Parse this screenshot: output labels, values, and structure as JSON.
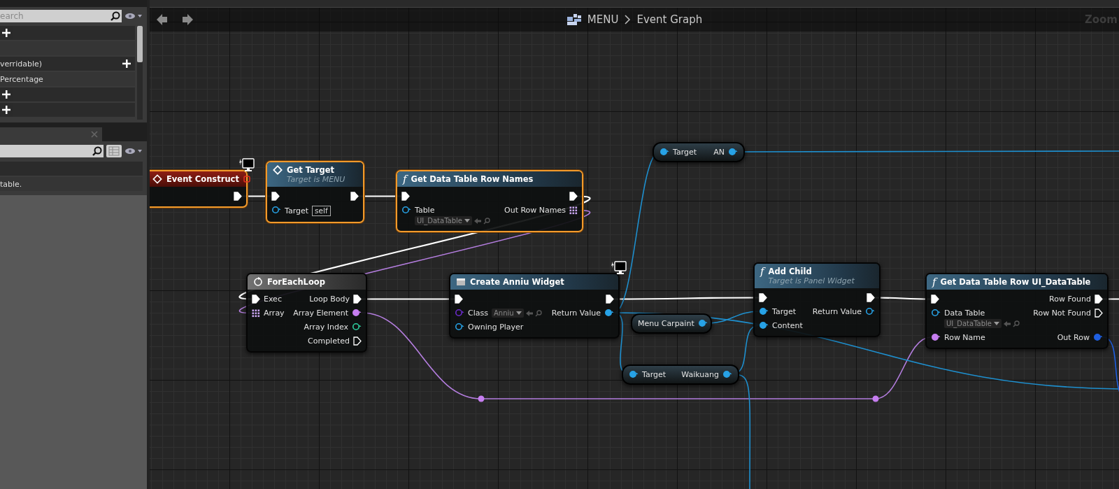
{
  "left_panel": {
    "search": {
      "placeholder": "earch"
    },
    "rows": [
      {
        "kind": "category",
        "addable": true
      },
      {
        "kind": "item"
      },
      {
        "kind": "category",
        "text": "verridable)",
        "addable": true
      },
      {
        "kind": "item",
        "text": "Percentage"
      },
      {
        "kind": "category",
        "addable": true
      },
      {
        "kind": "category",
        "addable": true
      }
    ]
  },
  "details_panel": {
    "closable_tab": true,
    "grid_view": true,
    "rows": [
      {
        "kind": "category"
      },
      {
        "kind": "item",
        "text": "table."
      }
    ]
  },
  "graph_header": {
    "breadcrumb": [
      "MENU",
      "Event Graph"
    ],
    "zoom_label": "Zoom"
  },
  "nodes": [
    {
      "kind": "event",
      "title": "Event Construct",
      "selected": true,
      "client_only": true,
      "delegate_pin": true,
      "outputs": [
        {
          "kind": "exec",
          "connected": true
        }
      ]
    },
    {
      "kind": "function",
      "title": "Get Target",
      "subtitle": "Target is MENU",
      "selected": true,
      "inputs": [
        {
          "kind": "exec",
          "connected": true
        },
        {
          "kind": "object",
          "label": "Target",
          "connected": false,
          "default": {
            "kind": "literal",
            "value": "self"
          }
        }
      ],
      "outputs": [
        {
          "kind": "exec",
          "connected": true
        }
      ]
    },
    {
      "kind": "function",
      "glyph": "f",
      "title": "Get Data Table Row Names",
      "selected": true,
      "inputs": [
        {
          "kind": "exec",
          "connected": true
        },
        {
          "kind": "object",
          "label": "Table",
          "connected": false,
          "default": {
            "kind": "asset",
            "value": "UI_DataTable"
          }
        }
      ],
      "outputs": [
        {
          "kind": "exec",
          "connected": true
        },
        {
          "kind": "array",
          "label": "Out Row Names",
          "connected": true
        }
      ]
    },
    {
      "kind": "macro",
      "title": "ForEachLoop",
      "selected": false,
      "inputs": [
        {
          "kind": "exec",
          "label": "Exec",
          "connected": true
        },
        {
          "kind": "array",
          "label": "Array",
          "connected": true
        }
      ],
      "outputs": [
        {
          "kind": "exec",
          "label": "Loop Body",
          "connected": true
        },
        {
          "kind": "name",
          "label": "Array Element",
          "connected": true
        },
        {
          "kind": "int",
          "label": "Array Index",
          "connected": false
        },
        {
          "kind": "exec",
          "label": "Completed",
          "connected": false
        }
      ]
    },
    {
      "kind": "function",
      "title": "Create Anniu Widget",
      "selected": false,
      "client_only": true,
      "inputs": [
        {
          "kind": "exec",
          "connected": true
        },
        {
          "kind": "class",
          "label": "Class",
          "connected": false,
          "default": {
            "kind": "asset",
            "value": "Anniu"
          }
        },
        {
          "kind": "object",
          "label": "Owning Player",
          "connected": false
        }
      ],
      "outputs": [
        {
          "kind": "exec",
          "connected": true
        },
        {
          "kind": "object",
          "label": "Return Value",
          "connected": true
        }
      ]
    },
    {
      "kind": "variable",
      "selected": false,
      "inputs": [
        {
          "kind": "object",
          "label": "Target",
          "connected": true
        }
      ],
      "outputs": [
        {
          "kind": "object",
          "label": "AN",
          "connected": true
        }
      ]
    },
    {
      "kind": "variable",
      "selected": false,
      "outputs": [
        {
          "kind": "object",
          "label": "Menu Carpaint",
          "connected": true
        }
      ]
    },
    {
      "kind": "variable",
      "selected": false,
      "inputs": [
        {
          "kind": "object",
          "label": "Target",
          "connected": true
        }
      ],
      "outputs": [
        {
          "kind": "object",
          "label": "Waikuang",
          "connected": true
        }
      ]
    },
    {
      "kind": "function",
      "glyph": "f",
      "title": "Add Child",
      "subtitle": "Target is Panel Widget",
      "selected": false,
      "inputs": [
        {
          "kind": "exec",
          "connected": true
        },
        {
          "kind": "object",
          "label": "Target",
          "connected": true
        },
        {
          "kind": "object",
          "label": "Content",
          "connected": true
        }
      ],
      "outputs": [
        {
          "kind": "exec",
          "connected": true
        },
        {
          "kind": "object",
          "label": "Return Value",
          "connected": false
        }
      ]
    },
    {
      "kind": "function",
      "glyph": "f",
      "title": "Get Data Table Row UI_DataTable",
      "selected": false,
      "inputs": [
        {
          "kind": "exec",
          "connected": true
        },
        {
          "kind": "object",
          "label": "Data Table",
          "connected": false,
          "default": {
            "kind": "asset",
            "value": "UI_DataTable"
          }
        },
        {
          "kind": "name",
          "label": "Row Name",
          "connected": true
        }
      ],
      "outputs": [
        {
          "kind": "exec",
          "label": "Row Found",
          "connected": true
        },
        {
          "kind": "exec",
          "label": "Row Not Found",
          "connected": false
        },
        {
          "kind": "struct",
          "label": "Out Row",
          "connected": true
        }
      ]
    }
  ]
}
